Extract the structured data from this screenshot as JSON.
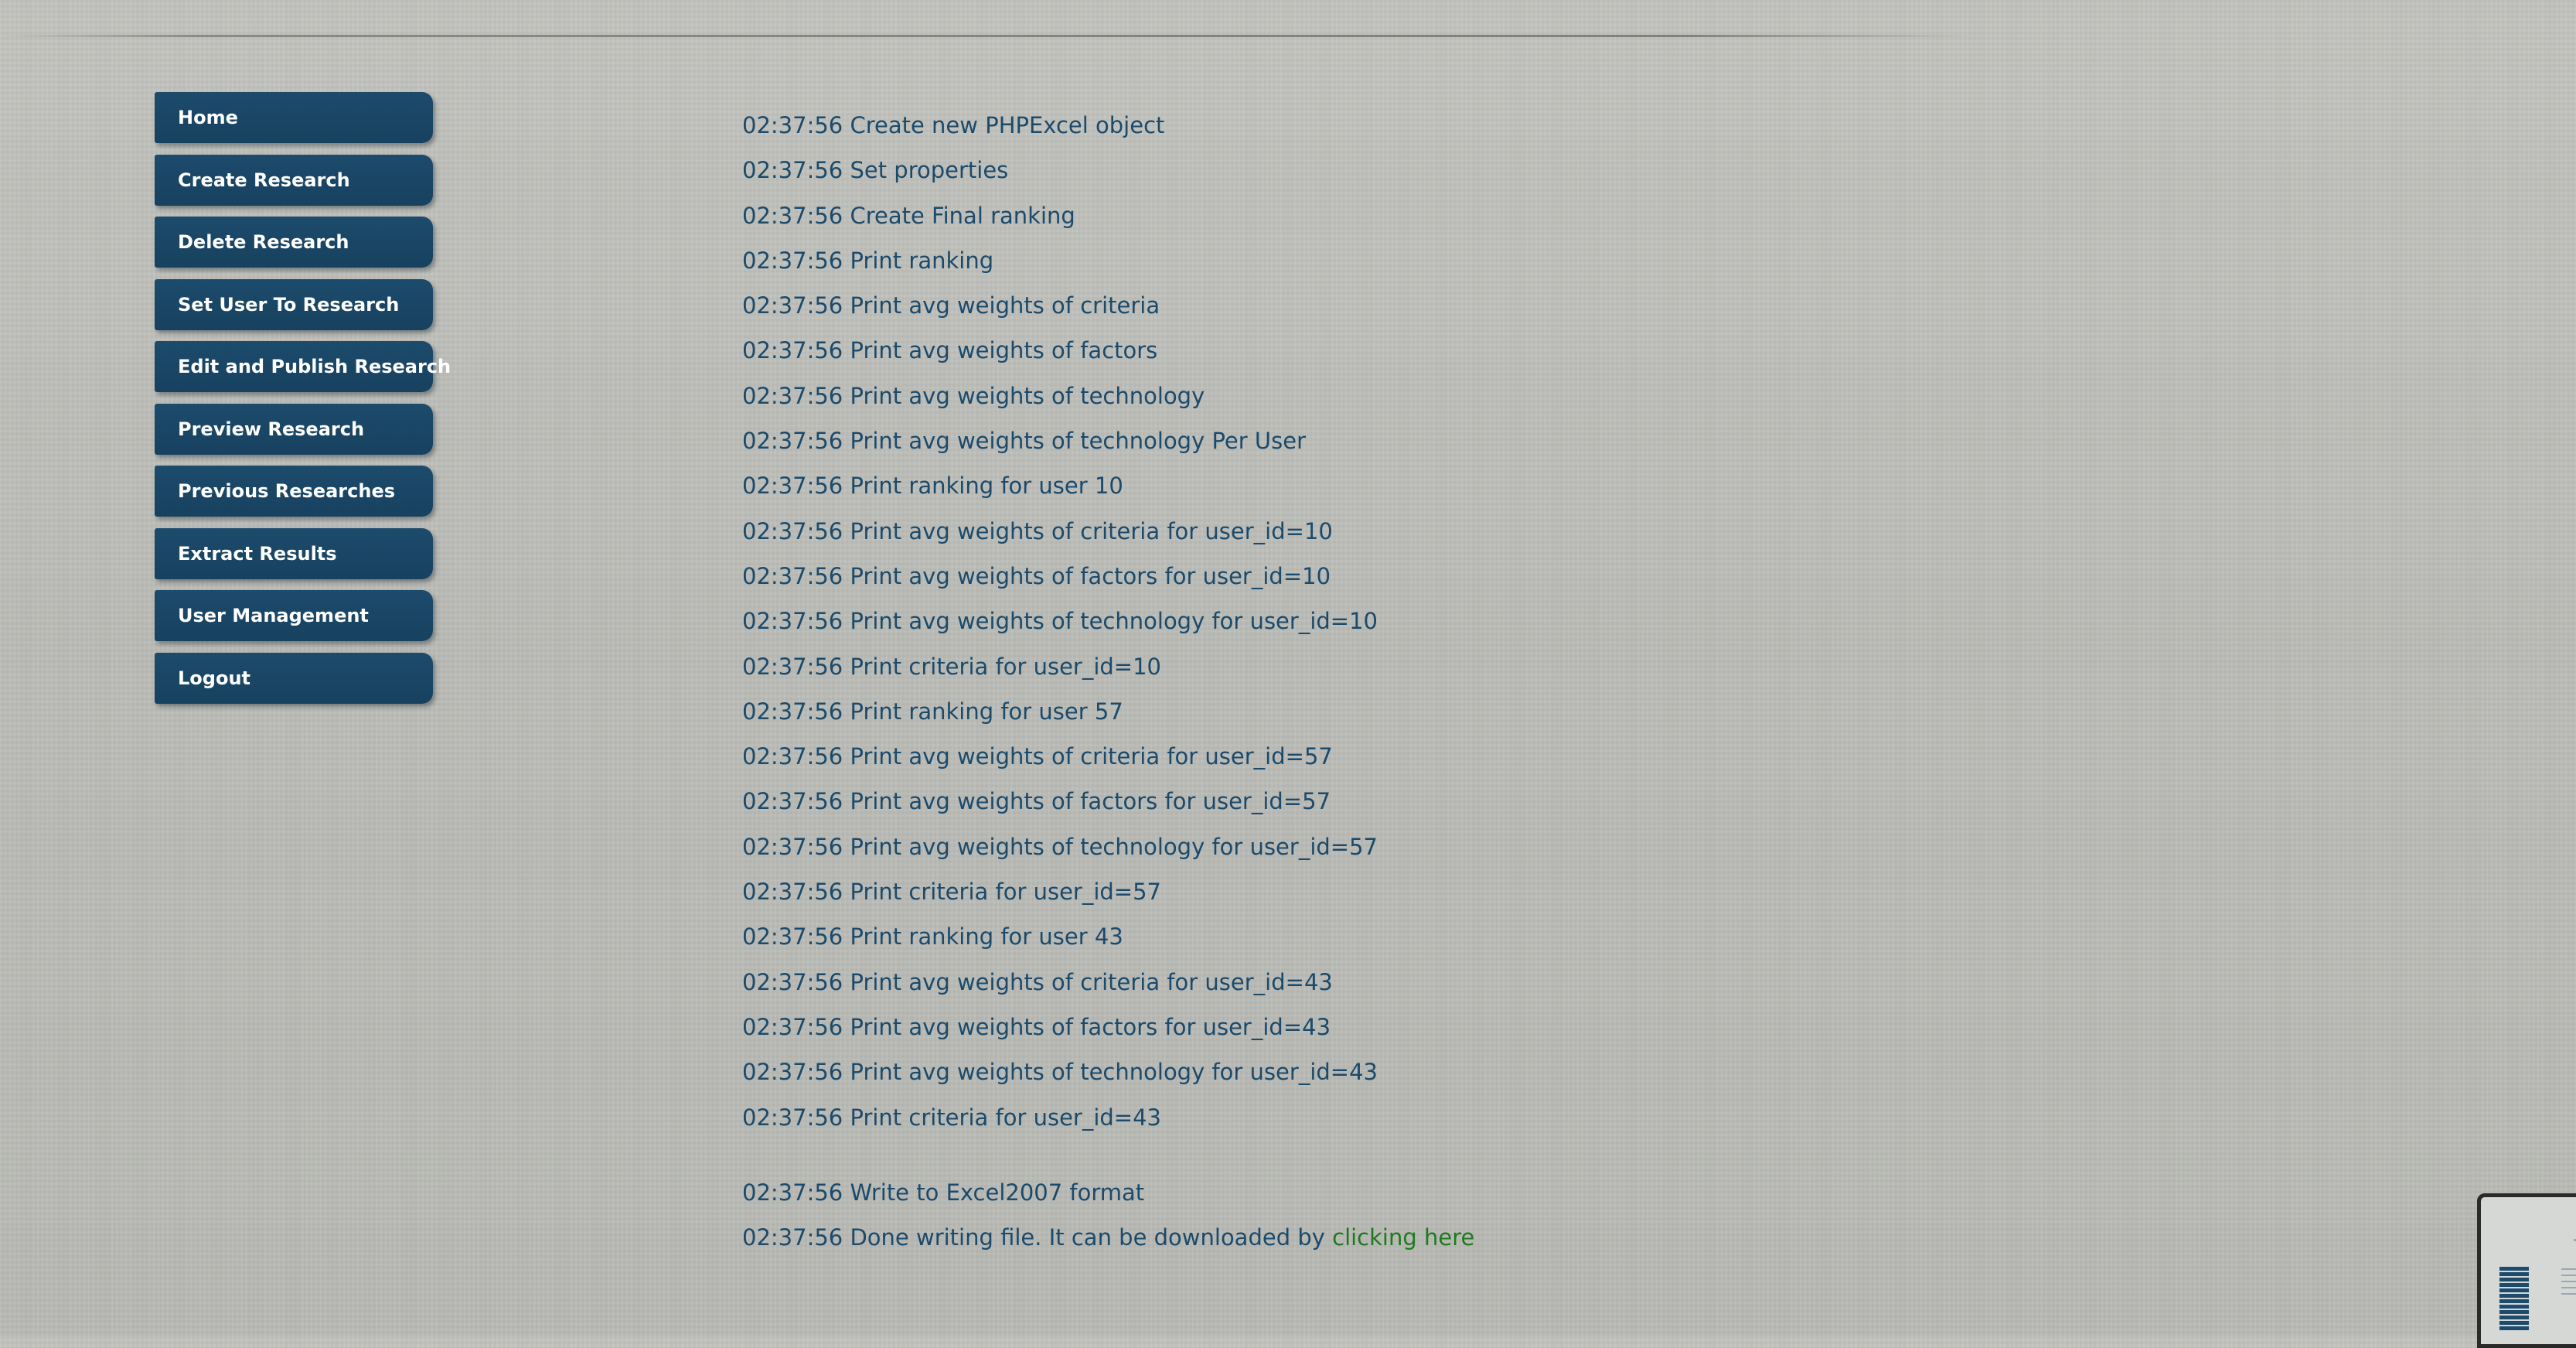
{
  "sidebar": {
    "items": [
      {
        "label": "Home"
      },
      {
        "label": "Create Research"
      },
      {
        "label": "Delete Research"
      },
      {
        "label": "Set User To Research"
      },
      {
        "label": "Edit and Publish Research"
      },
      {
        "label": "Preview Research"
      },
      {
        "label": "Previous Researches"
      },
      {
        "label": "Extract Results"
      },
      {
        "label": "User Management"
      },
      {
        "label": "Logout"
      }
    ]
  },
  "log": {
    "lines": [
      "02:37:56 Create new PHPExcel object",
      "02:37:56 Set properties",
      "02:37:56 Create Final ranking",
      "02:37:56 Print ranking",
      "02:37:56 Print avg weights of criteria",
      "02:37:56 Print avg weights of factors",
      "02:37:56 Print avg weights of technology",
      "02:37:56 Print avg weights of technology Per User",
      "02:37:56 Print ranking for user 10",
      "02:37:56 Print avg weights of criteria for user_id=10",
      "02:37:56 Print avg weights of factors for user_id=10",
      "02:37:56 Print avg weights of technology for user_id=10",
      "02:37:56 Print criteria for user_id=10",
      "02:37:56 Print ranking for user 57",
      "02:37:56 Print avg weights of criteria for user_id=57",
      "02:37:56 Print avg weights of factors for user_id=57",
      "02:37:56 Print avg weights of technology for user_id=57",
      "02:37:56 Print criteria for user_id=57",
      "02:37:56 Print ranking for user 43",
      "02:37:56 Print avg weights of criteria for user_id=43",
      "02:37:56 Print avg weights of factors for user_id=43",
      "02:37:56 Print avg weights of technology for user_id=43",
      "02:37:56 Print criteria for user_id=43"
    ],
    "write_line": "02:37:56 Write to Excel2007 format",
    "done_line": "02:37:56 Done writing file. It can be downloaded by",
    "download_link": "clicking here"
  },
  "colors": {
    "menu_bg": "#1b4669",
    "log_text": "#1b4a6b",
    "link": "#1f7a1f",
    "page_bg": "#bfc0bb"
  }
}
